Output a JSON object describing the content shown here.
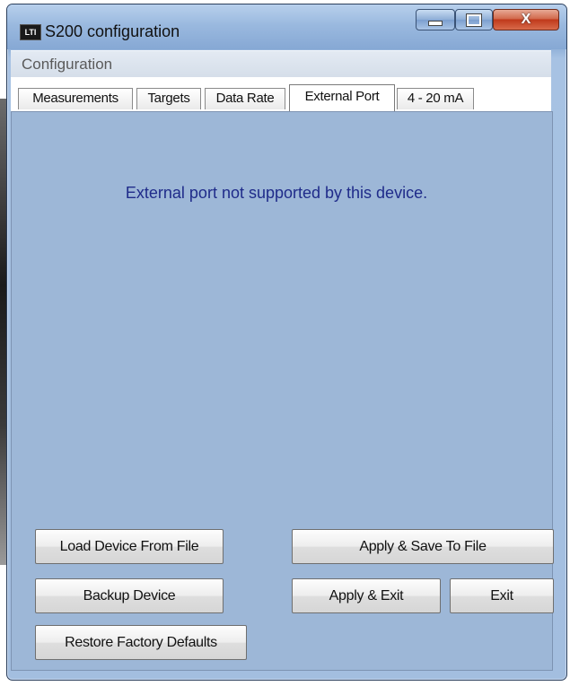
{
  "window": {
    "title": "S200 configuration",
    "icon_text": "LTI"
  },
  "menu": {
    "items": [
      "Configuration"
    ]
  },
  "tabs": [
    {
      "label": "Measurements",
      "active": false
    },
    {
      "label": "Targets",
      "active": false
    },
    {
      "label": "Data Rate",
      "active": false
    },
    {
      "label": "External Port",
      "active": true
    },
    {
      "label": "4 - 20 mA",
      "active": false
    }
  ],
  "content": {
    "message": "External  port not supported by this device."
  },
  "buttons": {
    "load_device": "Load Device From File",
    "apply_save": "Apply & Save To File",
    "backup_device": "Backup Device",
    "apply_exit": "Apply & Exit",
    "exit": "Exit",
    "restore_defaults": "Restore Factory Defaults"
  },
  "window_controls": {
    "close_glyph": "X"
  },
  "colors": {
    "content_bg": "#9db7d7",
    "message_text": "#1f2b8a",
    "close_button": "#c0391b"
  }
}
